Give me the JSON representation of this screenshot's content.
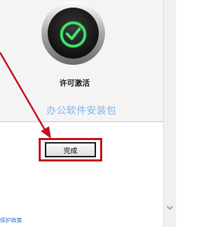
{
  "dialog": {
    "status_title": "许可激活",
    "watermark": "办公软件安装包",
    "done_button": "完成",
    "privacy_link": "保护政策"
  },
  "icons": {
    "badge": "checkmark-badge-icon",
    "scroll_down": "chevron-down-icon"
  },
  "colors": {
    "check_glow": "#3ee86a",
    "annotation_red": "#c0101a",
    "watermark": "#79b6ee",
    "link": "#2c6fca"
  }
}
